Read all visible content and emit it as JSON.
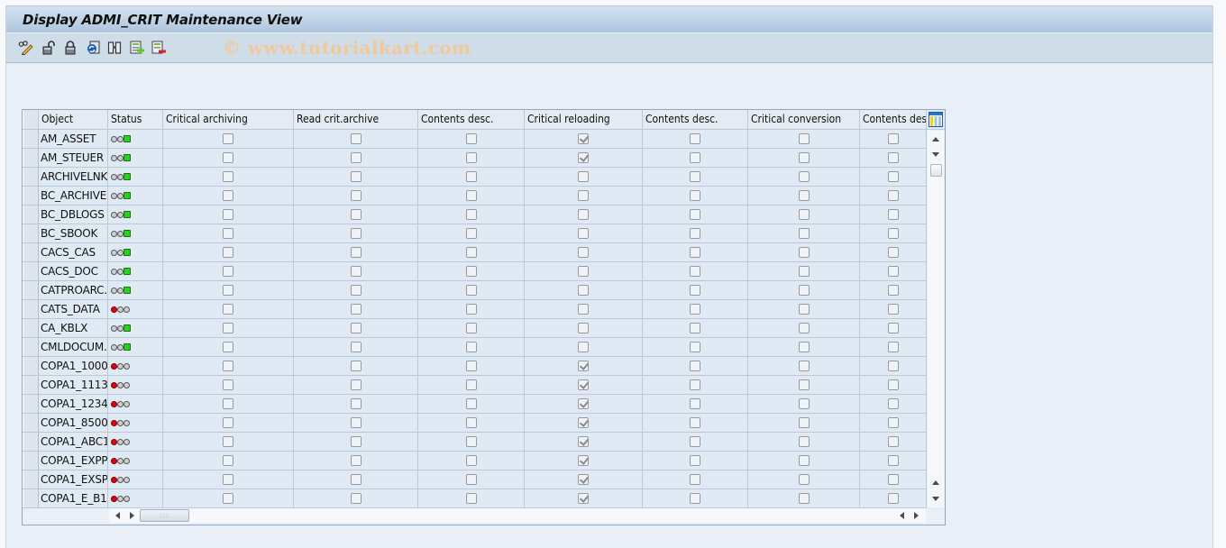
{
  "window": {
    "title": "Display ADMI_CRIT Maintenance View"
  },
  "toolbar": {
    "buttons": [
      {
        "name": "display-change-button",
        "icon": "pencil-glasses-icon"
      },
      {
        "name": "unlock-button",
        "icon": "unlocked-padlock-icon"
      },
      {
        "name": "lock-button",
        "icon": "locked-padlock-icon"
      },
      {
        "name": "refresh-button",
        "icon": "refresh-icon"
      },
      {
        "name": "find-button",
        "icon": "binoculars-icon"
      },
      {
        "name": "select-all-button",
        "icon": "select-all-icon"
      },
      {
        "name": "deselect-all-button",
        "icon": "deselect-all-icon"
      }
    ],
    "watermark": "© www.tutorialkart.com"
  },
  "table": {
    "columns": [
      "Object",
      "Status",
      "Critical archiving",
      "Read crit.archive",
      "Contents desc.",
      "Critical reloading",
      "Contents desc.",
      "Critical conversion",
      "Contents des"
    ],
    "status_colors": {
      "red": "#e8000b",
      "green": "#23d51f",
      "off": "#cfcfcf"
    },
    "rows": [
      {
        "object": "AM_ASSET",
        "status": "green",
        "checks": [
          false,
          false,
          false,
          true,
          false,
          false,
          false
        ]
      },
      {
        "object": "AM_STEUER",
        "status": "green",
        "checks": [
          false,
          false,
          false,
          true,
          false,
          false,
          false
        ]
      },
      {
        "object": "ARCHIVELNK",
        "status": "green",
        "checks": [
          false,
          false,
          false,
          false,
          false,
          false,
          false
        ]
      },
      {
        "object": "BC_ARCHIVE",
        "status": "green",
        "checks": [
          false,
          false,
          false,
          false,
          false,
          false,
          false
        ]
      },
      {
        "object": "BC_DBLOGS",
        "status": "green",
        "checks": [
          false,
          false,
          false,
          false,
          false,
          false,
          false
        ]
      },
      {
        "object": "BC_SBOOK",
        "status": "green",
        "checks": [
          false,
          false,
          false,
          false,
          false,
          false,
          false
        ]
      },
      {
        "object": "CACS_CAS",
        "status": "green",
        "checks": [
          false,
          false,
          false,
          false,
          false,
          false,
          false
        ]
      },
      {
        "object": "CACS_DOC",
        "status": "green",
        "checks": [
          false,
          false,
          false,
          false,
          false,
          false,
          false
        ]
      },
      {
        "object": "CATPROARC...",
        "status": "green",
        "checks": [
          false,
          false,
          false,
          false,
          false,
          false,
          false
        ]
      },
      {
        "object": "CATS_DATA",
        "status": "red",
        "checks": [
          false,
          false,
          false,
          false,
          false,
          false,
          false
        ]
      },
      {
        "object": "CA_KBLX",
        "status": "green",
        "checks": [
          false,
          false,
          false,
          false,
          false,
          false,
          false
        ]
      },
      {
        "object": "CMLDOCUM...",
        "status": "green",
        "checks": [
          false,
          false,
          false,
          false,
          false,
          false,
          false
        ]
      },
      {
        "object": "COPA1_1000",
        "status": "red",
        "checks": [
          false,
          false,
          false,
          true,
          false,
          false,
          false
        ]
      },
      {
        "object": "COPA1_1113",
        "status": "red",
        "checks": [
          false,
          false,
          false,
          true,
          false,
          false,
          false
        ]
      },
      {
        "object": "COPA1_1234",
        "status": "red",
        "checks": [
          false,
          false,
          false,
          true,
          false,
          false,
          false
        ]
      },
      {
        "object": "COPA1_8500",
        "status": "red",
        "checks": [
          false,
          false,
          false,
          true,
          false,
          false,
          false
        ]
      },
      {
        "object": "COPA1_ABC1",
        "status": "red",
        "checks": [
          false,
          false,
          false,
          true,
          false,
          false,
          false
        ]
      },
      {
        "object": "COPA1_EXPP",
        "status": "red",
        "checks": [
          false,
          false,
          false,
          true,
          false,
          false,
          false
        ]
      },
      {
        "object": "COPA1_EXSP",
        "status": "red",
        "checks": [
          false,
          false,
          false,
          true,
          false,
          false,
          false
        ]
      },
      {
        "object": "COPA1_E_B1",
        "status": "red",
        "checks": [
          false,
          false,
          false,
          true,
          false,
          false,
          false
        ]
      }
    ]
  }
}
